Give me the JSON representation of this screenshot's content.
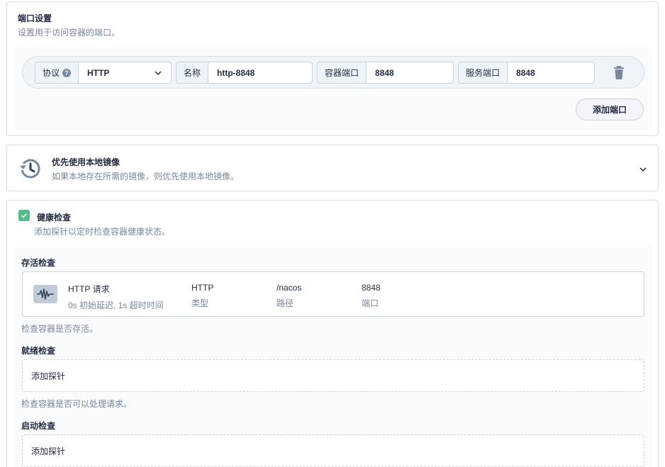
{
  "port_settings": {
    "title": "端口设置",
    "description": "设置用于访问容器的端口。",
    "protocol_label": "协议",
    "protocol_help": "?",
    "protocol_value": "HTTP",
    "name_label": "名称",
    "name_value": "http-8848",
    "container_port_label": "容器端口",
    "container_port_value": "8848",
    "service_port_label": "服务端口",
    "service_port_value": "8848",
    "add_port_label": "添加端口"
  },
  "local_image": {
    "title": "优先使用本地镜像",
    "description": "如果本地存在所需的镜像，则优先使用本地镜像。"
  },
  "health_check": {
    "title": "健康检查",
    "description": "添加探针以定时检查容器健康状态。",
    "checked": true,
    "liveness": {
      "title": "存活检查",
      "probe_type_name": "HTTP 请求",
      "probe_timing": "0s 初始延迟, 1s 超时时间",
      "type_value": "HTTP",
      "type_key": "类型",
      "path_value": "/nacos",
      "path_key": "路径",
      "port_value": "8848",
      "port_key": "端口",
      "description": "检查容器是否存活。"
    },
    "readiness": {
      "title": "就绪检查",
      "add_label": "添加探针",
      "description": "检查容器是否可以处理请求。"
    },
    "startup": {
      "title": "启动检查",
      "add_label": "添加探针"
    }
  },
  "colors": {
    "accent_green": "#55bc8a",
    "text_primary": "#242e42",
    "text_secondary": "#79879c"
  }
}
